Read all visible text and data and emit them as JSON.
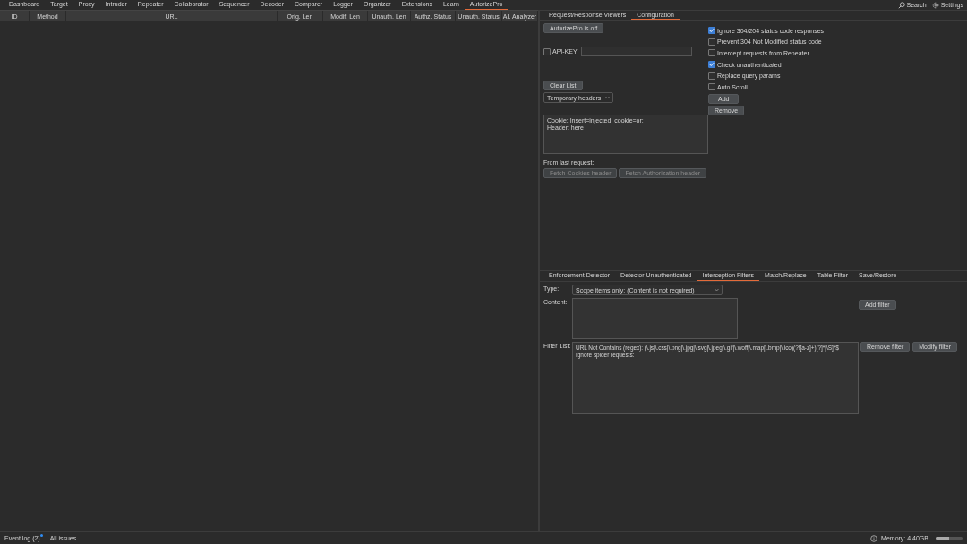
{
  "menu": [
    {
      "label": "Dashboard",
      "selected": false
    },
    {
      "label": "Target",
      "selected": false
    },
    {
      "label": "Proxy",
      "selected": false
    },
    {
      "label": "Intruder",
      "selected": false
    },
    {
      "label": "Repeater",
      "selected": false
    },
    {
      "label": "Collaborator",
      "selected": false
    },
    {
      "label": "Sequencer",
      "selected": false
    },
    {
      "label": "Decoder",
      "selected": false
    },
    {
      "label": "Comparer",
      "selected": false
    },
    {
      "label": "Logger",
      "selected": false
    },
    {
      "label": "Organizer",
      "selected": false
    },
    {
      "label": "Extensions",
      "selected": false
    },
    {
      "label": "Learn",
      "selected": false
    },
    {
      "label": "AutorizePro",
      "selected": true
    }
  ],
  "top_right": {
    "search": "Search",
    "settings": "Settings"
  },
  "table": {
    "columns": [
      "ID",
      "Method",
      "URL",
      "Orig. Len",
      "Modif. Len",
      "Unauth. Len",
      "Authz. Status",
      "Unauth. Status",
      "AI. Analyzer"
    ]
  },
  "viewer_tabs": [
    {
      "label": "Request/Response Viewers",
      "selected": false
    },
    {
      "label": "Configuration",
      "selected": true
    }
  ],
  "config": {
    "toggle_button": "AutorizePro is off",
    "api_key": {
      "label": "API-KEY",
      "checked": false
    },
    "clear_button": "Clear List",
    "header_dropdown": "Temporary headers",
    "headers_text": [
      "Cookie: Insert=injected; cookie=or;",
      "Header: here"
    ],
    "from_last_label": "From last request:",
    "fetch_buttons": [
      "Fetch Cookies header",
      "Fetch Authorization header"
    ],
    "options": [
      {
        "label": "Ignore 304/204 status code responses",
        "checked": true
      },
      {
        "label": "Prevent 304 Not Modified status code",
        "checked": false
      },
      {
        "label": "Intercept requests from Repeater",
        "checked": false
      },
      {
        "label": "Check unauthenticated",
        "checked": true
      },
      {
        "label": "Replace query params",
        "checked": false
      },
      {
        "label": "Auto Scroll",
        "checked": false
      }
    ],
    "add_button": "Add",
    "remove_button": "Remove"
  },
  "detector_tabs": [
    {
      "label": "Enforcement Detector",
      "selected": false
    },
    {
      "label": "Detector Unauthenticated",
      "selected": false
    },
    {
      "label": "Interception Filters",
      "selected": true
    },
    {
      "label": "Match/Replace",
      "selected": false
    },
    {
      "label": "Table Filter",
      "selected": false
    },
    {
      "label": "Save/Restore",
      "selected": false
    }
  ],
  "filters": {
    "type_label": "Type:",
    "type_value": "Scope items only: (Content is not required)",
    "content_label": "Content:",
    "add_filter": "Add filter",
    "filter_list_label": "Filter List:",
    "filter_list": [
      "URL Not Contains (regex): (\\.js|\\.css|\\.png|\\.jpg|\\.svg|\\.jpeg|\\.gif|\\.woff|\\.map|\\.bmp|\\.ico)(?![a-z]+)[?]*[\\S]*$",
      "Ignore spider requests:"
    ],
    "remove_filter": "Remove filter",
    "modify_filter": "Modify filter"
  },
  "status_bar": {
    "event_log": "Event log (2)",
    "all_issues": "All issues",
    "memory": "Memory: 4.40GB",
    "memory_level": {
      "level": 0.5
    }
  }
}
